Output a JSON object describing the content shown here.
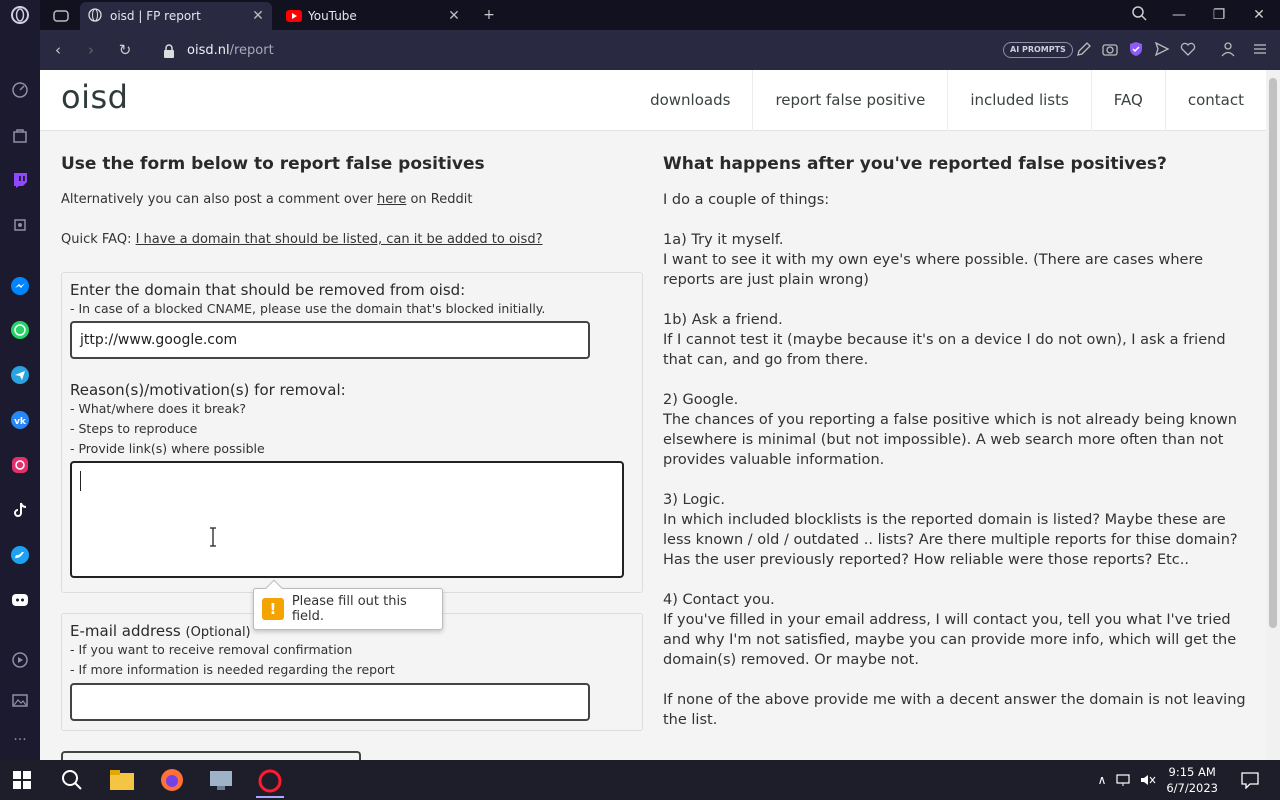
{
  "browser": {
    "tabs": [
      {
        "label": "oisd | FP report",
        "active": true
      },
      {
        "label": "YouTube",
        "active": false
      }
    ],
    "url_host": "oisd.nl",
    "url_path": "/report",
    "ai_badge": "AI PROMPTS"
  },
  "site": {
    "logo": "oisd",
    "nav": [
      "downloads",
      "report false positive",
      "included lists",
      "FAQ",
      "contact"
    ]
  },
  "left": {
    "heading": "Use the form below to report false positives",
    "alt_prefix": "Alternatively you can also post a comment over ",
    "alt_link": "here",
    "alt_suffix": " on Reddit",
    "faq_prefix": "Quick FAQ: ",
    "faq_link": "I have a domain that should be listed, can it be added to oisd?",
    "domain_label": "Enter the domain that should be removed from oisd:",
    "domain_hint": "- In case of a blocked CNAME, please use the domain that's blocked initially.",
    "domain_value": "jttp://www.google.com",
    "reason_label": "Reason(s)/motivation(s) for removal:",
    "reason_hints": [
      "- What/where does it break?",
      "- Steps to reproduce",
      "- Provide link(s) where possible"
    ],
    "tooltip": "Please fill out this field.",
    "email_label": "E-mail address",
    "email_optional": "(Optional)",
    "email_hints": [
      "- If you want to receive removal confirmation",
      "- If more information is needed regarding the report"
    ]
  },
  "right": {
    "heading": "What happens after you've reported false positives?",
    "paragraphs": [
      [
        "I do a couple of things:"
      ],
      [
        "1a) Try it myself.",
        "I want to see it with my own eye's where possible. (There are cases where reports are just plain wrong)"
      ],
      [
        "1b) Ask a friend.",
        "If I cannot test it (maybe because it's on a device I do not own), I ask a friend that can, and go from there."
      ],
      [
        "2) Google.",
        "The chances of you reporting a false positive which is not already being known elsewhere is minimal (but not impossible). A web search more often than not provides valuable information."
      ],
      [
        "3) Logic.",
        "In which included blocklists is the reported domain is listed? Maybe these are less known / old / outdated .. lists? Are there multiple reports for thise domain? Has the user previously reported? How reliable were those reports? Etc.."
      ],
      [
        "4) Contact you.",
        "If you've filled in your email address, I will contact you, tell you what I've tried and why I'm not satisfied, maybe you can provide more info, which will get the domain(s) removed. Or maybe not."
      ],
      [
        "If none of the above provide me with a decent answer the domain is not leaving the list."
      ]
    ]
  },
  "taskbar": {
    "time": "9:15 AM",
    "date": "6/7/2023"
  },
  "colors": {
    "sidebar": "#1b1a2e",
    "addressbar": "#2a2942",
    "taskbar": "#1e1e2a",
    "warning": "#f5a300"
  }
}
